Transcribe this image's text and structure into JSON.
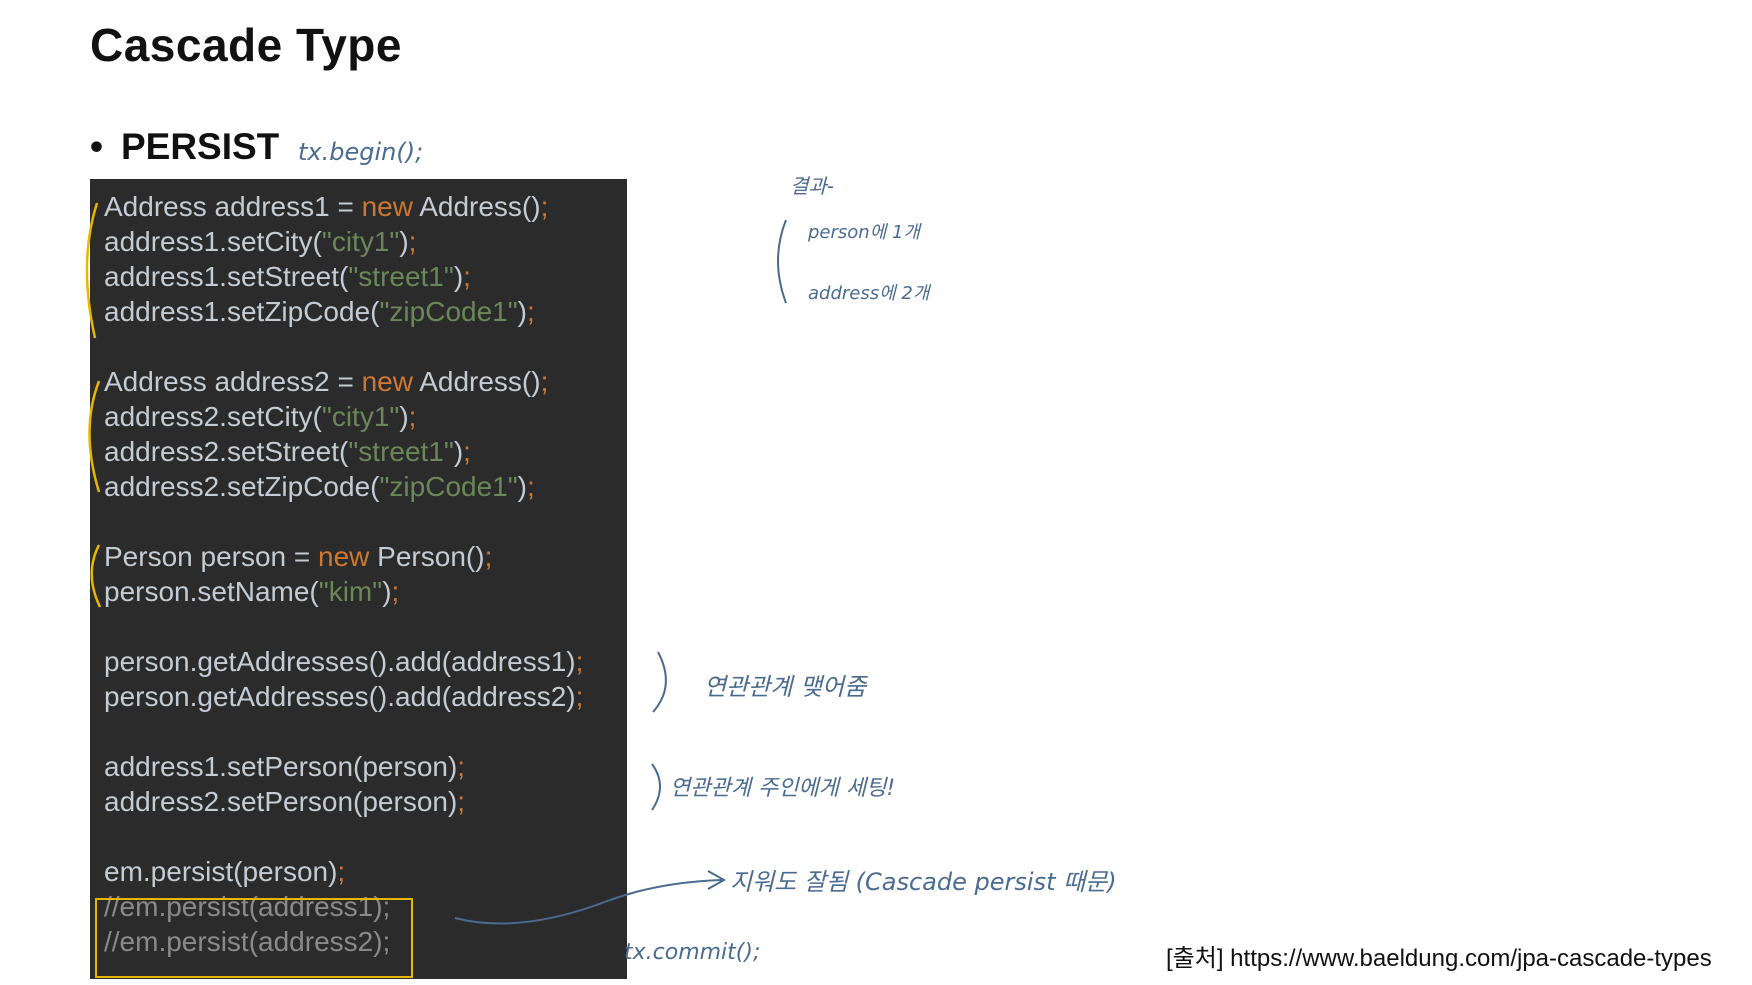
{
  "slide": {
    "title": "Cascade Type",
    "bullet": "PERSIST"
  },
  "code": {
    "lines": [
      [
        {
          "t": "Address address1 = "
        },
        {
          "t": "new",
          "c": "kw"
        },
        {
          "t": " Address()"
        },
        {
          "t": ";",
          "c": "sc"
        }
      ],
      [
        {
          "t": "address1.setCity("
        },
        {
          "t": "\"city1\"",
          "c": "str"
        },
        {
          "t": ")"
        },
        {
          "t": ";",
          "c": "sc"
        }
      ],
      [
        {
          "t": "address1.setStreet("
        },
        {
          "t": "\"street1\"",
          "c": "str"
        },
        {
          "t": ")"
        },
        {
          "t": ";",
          "c": "sc"
        }
      ],
      [
        {
          "t": "address1.setZipCode("
        },
        {
          "t": "\"zipCode1\"",
          "c": "str"
        },
        {
          "t": ")"
        },
        {
          "t": ";",
          "c": "sc"
        }
      ],
      [],
      [
        {
          "t": "Address address2 = "
        },
        {
          "t": "new",
          "c": "kw"
        },
        {
          "t": " Address()"
        },
        {
          "t": ";",
          "c": "sc"
        }
      ],
      [
        {
          "t": "address2.setCity("
        },
        {
          "t": "\"city1\"",
          "c": "str"
        },
        {
          "t": ")"
        },
        {
          "t": ";",
          "c": "sc"
        }
      ],
      [
        {
          "t": "address2.setStreet("
        },
        {
          "t": "\"street1\"",
          "c": "str"
        },
        {
          "t": ")"
        },
        {
          "t": ";",
          "c": "sc"
        }
      ],
      [
        {
          "t": "address2.setZipCode("
        },
        {
          "t": "\"zipCode1\"",
          "c": "str"
        },
        {
          "t": ")"
        },
        {
          "t": ";",
          "c": "sc"
        }
      ],
      [],
      [
        {
          "t": "Person person = "
        },
        {
          "t": "new",
          "c": "kw"
        },
        {
          "t": " Person()"
        },
        {
          "t": ";",
          "c": "sc"
        }
      ],
      [
        {
          "t": "person.setName("
        },
        {
          "t": "\"kim\"",
          "c": "str"
        },
        {
          "t": ")"
        },
        {
          "t": ";",
          "c": "sc"
        }
      ],
      [],
      [
        {
          "t": "person.getAddresses().add(address1)"
        },
        {
          "t": ";",
          "c": "sc"
        }
      ],
      [
        {
          "t": "person.getAddresses().add(address2)"
        },
        {
          "t": ";",
          "c": "sc"
        }
      ],
      [],
      [
        {
          "t": "address1.setPerson(person)"
        },
        {
          "t": ";",
          "c": "sc"
        }
      ],
      [
        {
          "t": "address2.setPerson(person)"
        },
        {
          "t": ";",
          "c": "sc"
        }
      ],
      [],
      [
        {
          "t": "em.persist(person)"
        },
        {
          "t": ";",
          "c": "sc"
        }
      ],
      [
        {
          "t": "//em.persist(address1);",
          "c": "cm"
        }
      ],
      [
        {
          "t": "//em.persist(address2);",
          "c": "cm"
        }
      ]
    ]
  },
  "notes": {
    "tx_begin": "tx.begin();",
    "result_title": "결과-",
    "result_person": "person에 1개",
    "result_address": "address에 2개",
    "link_note": "연관관계 맺어줌",
    "owner_note": "연관관계 주인에게 세팅!",
    "cascade_note": "지워도 잘됨 (Cascade persist 때문)",
    "tx_commit": "tx.commit();"
  },
  "source": {
    "label": "[출처]",
    "url": "https://www.baeldung.com/jpa-cascade-types"
  },
  "colors": {
    "code_bg": "#2b2b2b",
    "code_text": "#c3cbd4",
    "keyword": "#cc7832",
    "string": "#6a8759",
    "comment": "#8a8a8a",
    "highlight": "#e8b500",
    "handwriting": "#4a6b8f"
  }
}
